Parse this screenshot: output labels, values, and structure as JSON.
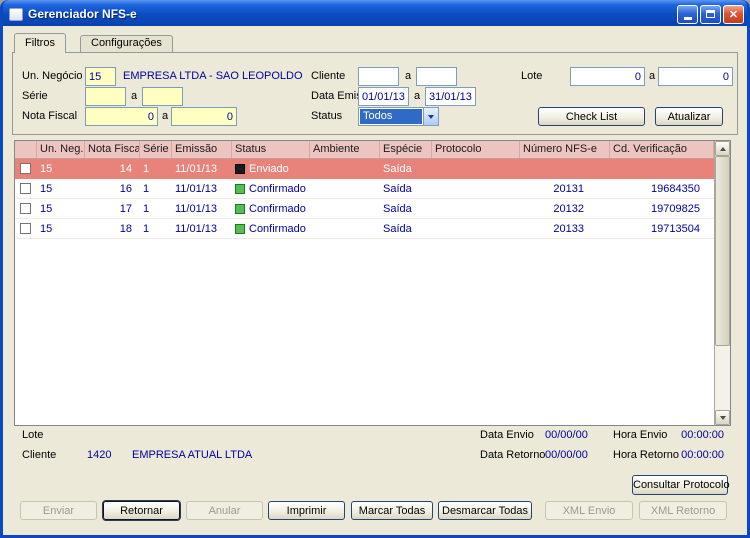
{
  "window": {
    "title": "Gerenciador NFS-e"
  },
  "tabs": [
    {
      "label": "Filtros"
    },
    {
      "label": "Configurações"
    }
  ],
  "filters": {
    "range_separator": "a",
    "un_negocio_label": "Un. Negócio",
    "un_negocio_value": "15",
    "un_negocio_name": "EMPRESA LTDA - SAO LEOPOLDO",
    "serie_label": "Série",
    "serie_from": "",
    "serie_to": "",
    "nota_fiscal_label": "Nota Fiscal",
    "nota_fiscal_from": "0",
    "nota_fiscal_to": "0",
    "cliente_label": "Cliente",
    "cliente_from": "",
    "cliente_to": "",
    "data_emissao_label": "Data Emissão",
    "data_emissao_from": "01/01/13",
    "data_emissao_to": "31/01/13",
    "status_label": "Status",
    "status_value": "Todos",
    "lote_label": "Lote",
    "lote_from": "0",
    "lote_to": "0",
    "check_list_button": "Check List",
    "atualizar_button": "Atualizar"
  },
  "grid": {
    "columns": {
      "un_neg": "Un. Neg.",
      "nota_fiscal": "Nota Fiscal",
      "serie": "Série",
      "emissao": "Emissão",
      "status": "Status",
      "ambiente": "Ambiente",
      "especie": "Espécie",
      "protocolo": "Protocolo",
      "numero_nfse": "Número NFS-e",
      "cd_verificacao": "Cd. Verificação"
    },
    "rows": [
      {
        "un_neg": "15",
        "nota_fiscal": "14",
        "serie": "1",
        "emissao": "11/01/13",
        "status": "Enviado",
        "ambiente": "",
        "especie": "Saída",
        "protocolo": "",
        "numero_nfse": "",
        "cd_verificacao": "",
        "selected": true
      },
      {
        "un_neg": "15",
        "nota_fiscal": "16",
        "serie": "1",
        "emissao": "11/01/13",
        "status": "Confirmado",
        "ambiente": "",
        "especie": "Saída",
        "protocolo": "",
        "numero_nfse": "20131",
        "cd_verificacao": "19684350",
        "selected": false
      },
      {
        "un_neg": "15",
        "nota_fiscal": "17",
        "serie": "1",
        "emissao": "11/01/13",
        "status": "Confirmado",
        "ambiente": "",
        "especie": "Saída",
        "protocolo": "",
        "numero_nfse": "20132",
        "cd_verificacao": "19709825",
        "selected": false
      },
      {
        "un_neg": "15",
        "nota_fiscal": "18",
        "serie": "1",
        "emissao": "11/01/13",
        "status": "Confirmado",
        "ambiente": "",
        "especie": "Saída",
        "protocolo": "",
        "numero_nfse": "20133",
        "cd_verificacao": "19713504",
        "selected": false
      }
    ]
  },
  "details": {
    "lote_label": "Lote",
    "lote_value": "",
    "cliente_label": "Cliente",
    "cliente_code": "1420",
    "cliente_name": "EMPRESA ATUAL LTDA",
    "data_envio_label": "Data Envio",
    "data_envio_value": "00/00/00",
    "hora_envio_label": "Hora Envio",
    "hora_envio_value": "00:00:00",
    "data_retorno_label": "Data Retorno",
    "data_retorno_value": "00/00/00",
    "hora_retorno_label": "Hora Retorno",
    "hora_retorno_value": "00:00:00",
    "consultar_protocolo_button": "Consultar Protocolo"
  },
  "actions": [
    {
      "label": "Enviar",
      "enabled": false
    },
    {
      "label": "Retornar",
      "enabled": true
    },
    {
      "label": "Anular",
      "enabled": false
    },
    {
      "label": "Imprimir",
      "enabled": true
    },
    {
      "label": "Marcar Todas",
      "enabled": true
    },
    {
      "label": "Desmarcar Todas",
      "enabled": true
    },
    {
      "label": "XML Envio",
      "enabled": false
    },
    {
      "label": "XML Retorno",
      "enabled": false
    }
  ],
  "colors": {
    "titlebar_blue": "#0B49BE",
    "panel_beige": "#ECE9D8",
    "grid_header_pink": "#EDC5C0",
    "selected_row": "#E8837B",
    "value_text_navy": "#0000A0",
    "required_field_yellow": "#FFFFC2",
    "status_enviado": "#1A1A1A",
    "status_confirmado": "#54BE54"
  }
}
